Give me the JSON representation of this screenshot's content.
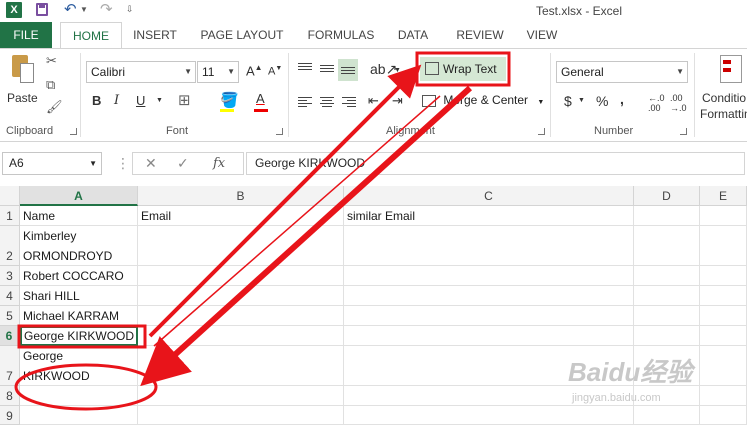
{
  "window": {
    "logo": "X",
    "title": "Test.xlsx - Excel"
  },
  "tabs": [
    {
      "label": "FILE"
    },
    {
      "label": "HOME"
    },
    {
      "label": "INSERT"
    },
    {
      "label": "PAGE LAYOUT"
    },
    {
      "label": "FORMULAS"
    },
    {
      "label": "DATA"
    },
    {
      "label": "REVIEW"
    },
    {
      "label": "VIEW"
    }
  ],
  "ribbon": {
    "clipboard": {
      "paste_label": "Paste",
      "group_label": "Clipboard"
    },
    "font": {
      "name": "Calibri",
      "size": "11",
      "bold": "B",
      "italic": "I",
      "underline": "U",
      "group_label": "Font"
    },
    "alignment": {
      "wrap_text": "Wrap Text",
      "merge_center": "Merge & Center",
      "group_label": "Alignment"
    },
    "number": {
      "format": "General",
      "currency": "$",
      "percent": "%",
      "group_label": "Number"
    },
    "styles": {
      "conditional": "Conditio",
      "formatting": "Formattin"
    }
  },
  "formula_bar": {
    "name_box": "A6",
    "fx_label": "fx",
    "content": "George KIRKWOOD"
  },
  "columns": [
    "A",
    "B",
    "C",
    "D",
    "E"
  ],
  "rows": [
    {
      "num": "1",
      "a": "Name",
      "b": "Email",
      "c": "similar Email"
    },
    {
      "num": "2",
      "a": "Kimberley ORMONDROYD",
      "b": "",
      "c": ""
    },
    {
      "num": "3",
      "a": "Robert COCCARO",
      "b": "",
      "c": ""
    },
    {
      "num": "4",
      "a": "Shari HILL",
      "b": "",
      "c": ""
    },
    {
      "num": "5",
      "a": "Michael KARRAM",
      "b": "",
      "c": ""
    },
    {
      "num": "6",
      "a": "George KIRKWOOD",
      "b": "",
      "c": ""
    },
    {
      "num": "7",
      "a": "George KIRKWOOD",
      "b": "",
      "c": ""
    },
    {
      "num": "8",
      "a": "",
      "b": "",
      "c": ""
    },
    {
      "num": "9",
      "a": "",
      "b": "",
      "c": ""
    }
  ],
  "colors": {
    "accent": "#217346",
    "annotation": "#e8141a"
  },
  "watermark": {
    "brand": "Baidu经验",
    "url": "jingyan.baidu.com"
  }
}
